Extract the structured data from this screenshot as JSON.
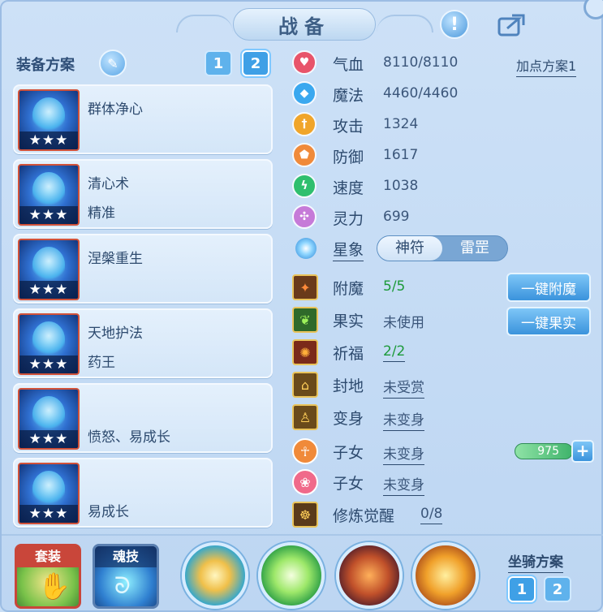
{
  "header": {
    "title": "战备"
  },
  "equip_scheme": {
    "title": "装备方案",
    "buttons": [
      "1",
      "2"
    ]
  },
  "cards": [
    {
      "line1": "群体净心",
      "line2": "",
      "stars": "★★★"
    },
    {
      "line1": "清心术",
      "line2": "精准",
      "stars": "★★★"
    },
    {
      "line1": "涅槃重生",
      "line2": "",
      "stars": "★★★"
    },
    {
      "line1": "天地护法",
      "line2": "药王",
      "stars": "★★★"
    },
    {
      "line1": "",
      "line2": "愤怒、易成长",
      "stars": "★★★"
    },
    {
      "line1": "",
      "line2": "易成长",
      "stars": "★★★"
    }
  ],
  "stats": {
    "plan_link": "加点方案1",
    "rows": [
      {
        "name": "气血",
        "value": "8110/8110",
        "icon": "heart-icon",
        "color": "#e8546a"
      },
      {
        "name": "魔法",
        "value": "4460/4460",
        "icon": "mana-icon",
        "color": "#3aa8ef"
      },
      {
        "name": "攻击",
        "value": "1324",
        "icon": "sword-icon",
        "color": "#f0a52a"
      },
      {
        "name": "防御",
        "value": "1617",
        "icon": "shield-icon",
        "color": "#f08a3a"
      },
      {
        "name": "速度",
        "value": "1038",
        "icon": "speed-icon",
        "color": "#2fbf6e"
      },
      {
        "name": "灵力",
        "value": "699",
        "icon": "spirit-icon",
        "color": "#c67ad8"
      }
    ],
    "star": {
      "label": "星象",
      "options": [
        "神符",
        "雷罡"
      ]
    }
  },
  "bonus": [
    {
      "name": "附魔",
      "value": "5/5",
      "green": true,
      "underline": false
    },
    {
      "name": "果实",
      "value": "未使用",
      "green": false,
      "underline": false
    },
    {
      "name": "祈福",
      "value": "2/2",
      "green": true,
      "underline": true
    },
    {
      "name": "封地",
      "value": "未受赏",
      "green": false,
      "underline": true
    },
    {
      "name": "变身",
      "value": "未变身",
      "green": false,
      "underline": true
    },
    {
      "name": "子女",
      "value": "未变身",
      "green": false,
      "underline": true
    },
    {
      "name": "子女",
      "value": "未变身",
      "green": false,
      "underline": true
    },
    {
      "name": "修炼觉醒",
      "value": "0/8",
      "green": false,
      "underline": true
    }
  ],
  "actions": {
    "enchant": "一键附魔",
    "fruit": "一键果实"
  },
  "cultivation": {
    "value": "975"
  },
  "bottom": {
    "set_label": "套装",
    "soul_label": "魂技",
    "mount_title": "坐骑方案",
    "mount_buttons": [
      "1",
      "2"
    ]
  }
}
